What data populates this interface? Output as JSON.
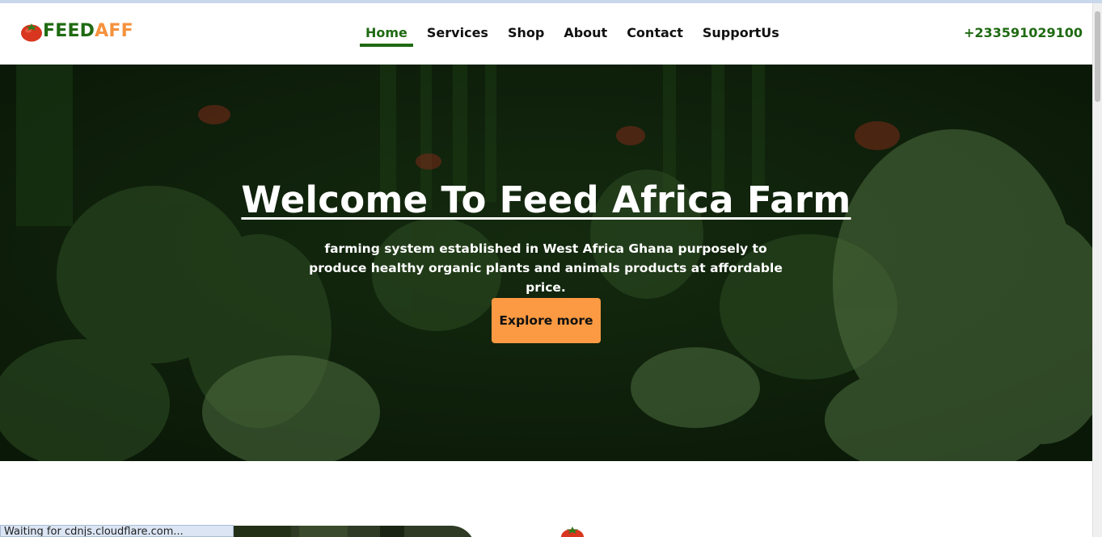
{
  "brand": {
    "part1": "FEED",
    "part2": "AFF",
    "icon": "tomato-icon"
  },
  "nav": {
    "items": [
      {
        "label": "Home",
        "active": true
      },
      {
        "label": "Services"
      },
      {
        "label": "Shop"
      },
      {
        "label": "About"
      },
      {
        "label": "Contact"
      },
      {
        "label": "SupportUs"
      }
    ],
    "phone": "+233591029100"
  },
  "hero": {
    "title": "Welcome To Feed Africa Farm",
    "subtitle": "farming system established in West Africa Ghana purposely to produce healthy organic plants and animals products at affordable price.",
    "button_label": "Explore more",
    "background": "chicken-coop-photo"
  },
  "status_bar": {
    "text": "Waiting for cdnjs.cloudflare.com..."
  },
  "colors": {
    "brand_green": "#1f6a12",
    "brand_orange": "#f5923e",
    "button_orange": "#fb9a42",
    "hero_overlay": "#0b1c08"
  }
}
